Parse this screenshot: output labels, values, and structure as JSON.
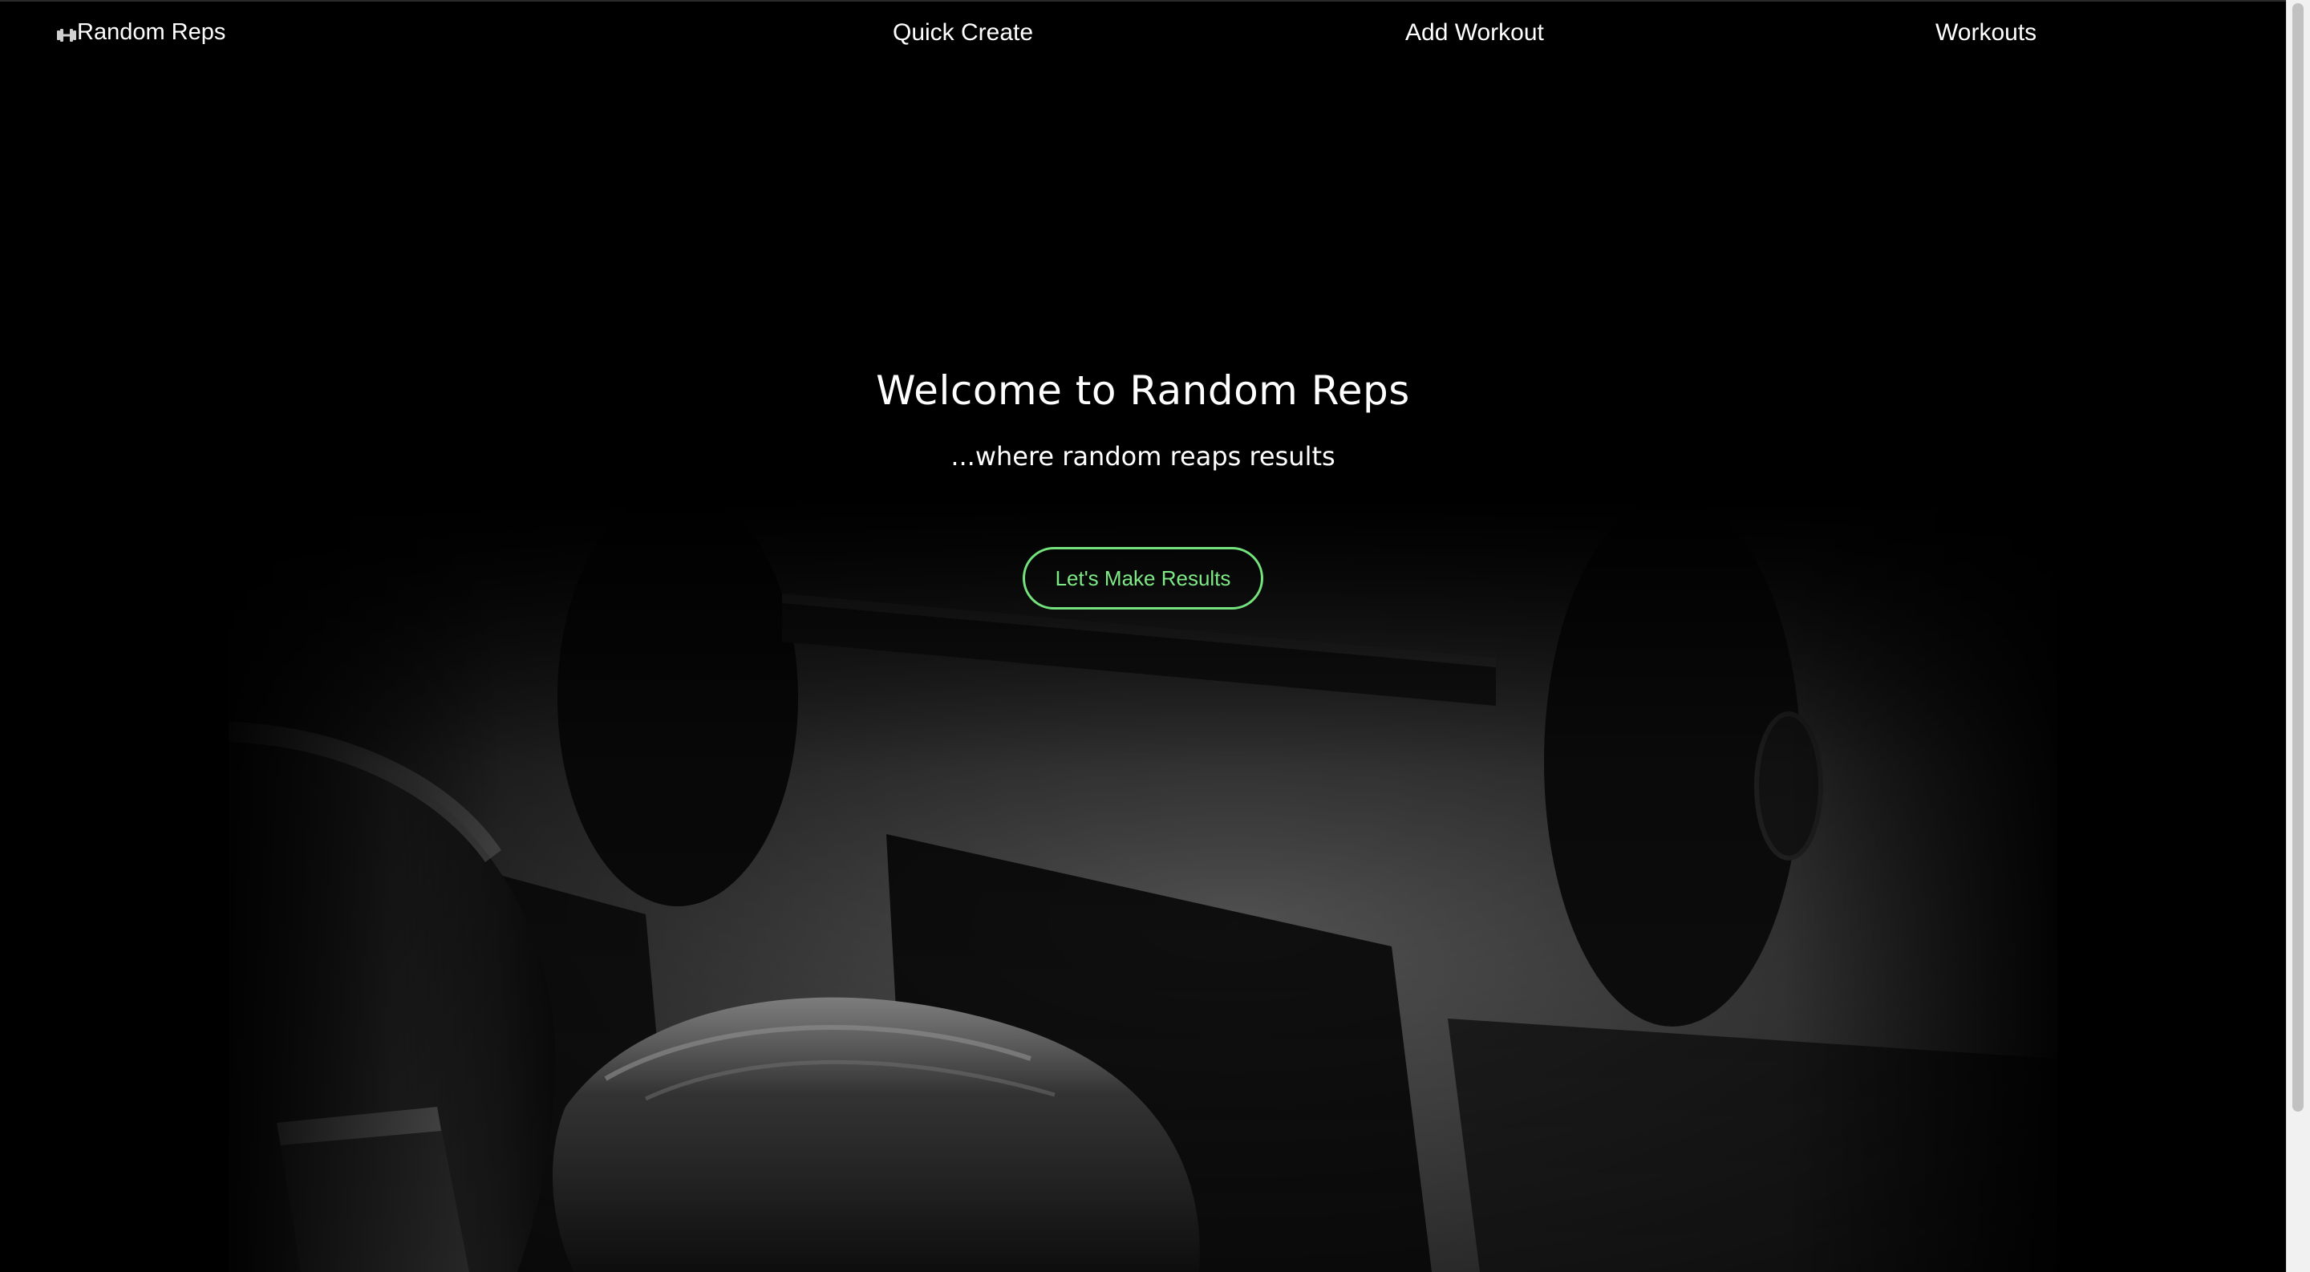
{
  "navbar": {
    "brand_icon": "dumbbell-icon",
    "brand_label": "Random Reps",
    "links": {
      "quick_create": "Quick Create",
      "add_workout": "Add Workout",
      "workouts": "Workouts"
    }
  },
  "hero": {
    "title": "Welcome to Random Reps",
    "subtitle": "...where random reaps results",
    "cta_label": "Let's Make Results",
    "background_image": "dumbbells-on-gym-floor"
  },
  "colors": {
    "background": "#000000",
    "text": "#ffffff",
    "accent": "#74e37d"
  }
}
